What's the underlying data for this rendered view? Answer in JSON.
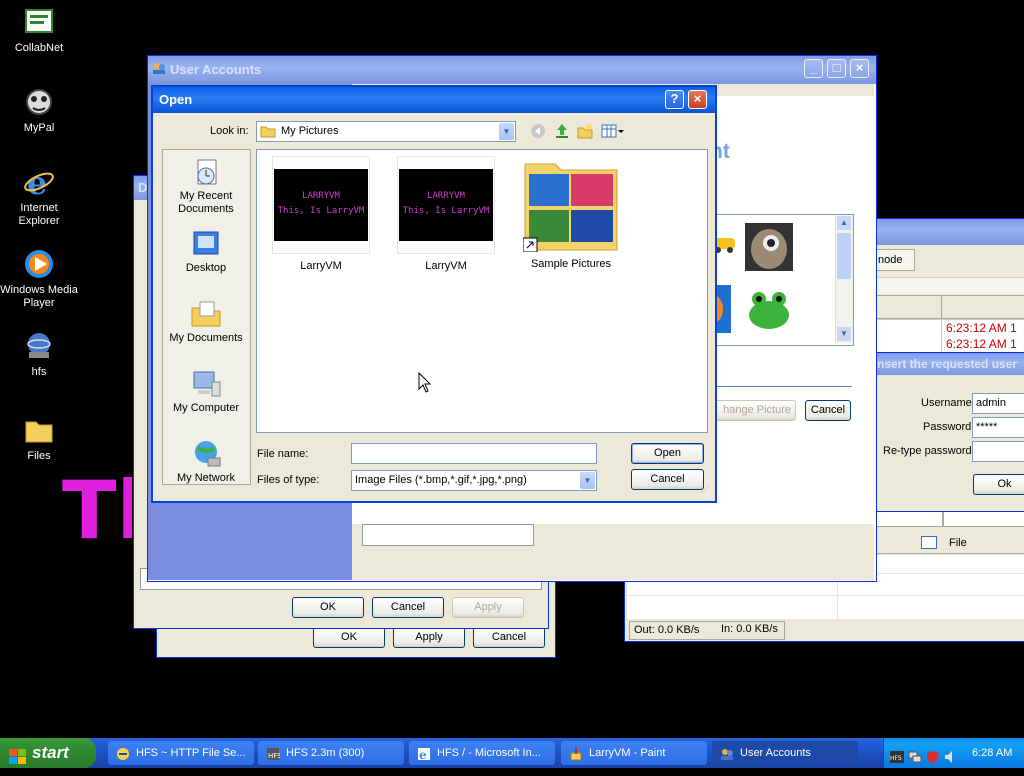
{
  "desktop": {
    "icons": [
      "CollabNet",
      "MyPal",
      "Internet Explorer",
      "Windows Media Player",
      "hfs",
      "Files"
    ],
    "background_text": "Th"
  },
  "user_accounts": {
    "title": "User Accounts",
    "heading_fragment": "nt",
    "change_picture_label": "hange Picture",
    "cancel_label": "Cancel",
    "ok_label": "OK",
    "apply_label": "Apply"
  },
  "back_dialog": {
    "title": "D",
    "ok_label": "OK",
    "cancel_label": "Cancel",
    "apply_label": "Apply"
  },
  "third_dialog": {
    "ok_label": "OK",
    "apply_label": "Apply",
    "cancel_label": "Cancel"
  },
  "hfs_window": {
    "column_fragment": "node",
    "log_time_1": "6:23:12 AM 1",
    "log_time_2": "6:23:12 AM 1",
    "file_column": "File",
    "status_out": "Out: 0.0 KB/s",
    "status_in": "In: 0.0 KB/s"
  },
  "login_dialog": {
    "title_fragment": "nsert the requested user",
    "username_label": "Username",
    "username_value": "admin",
    "password_label": "Password",
    "password_value": "*****",
    "retype_label": "Re-type password",
    "ok_label": "Ok"
  },
  "open_dialog": {
    "title": "Open",
    "look_in_label": "Look in:",
    "look_in_value": "My Pictures",
    "places": [
      "My Recent Documents",
      "Desktop",
      "My Documents",
      "My Computer",
      "My Network"
    ],
    "files": [
      {
        "name": "LarryVM",
        "thumb_line1": "LARRYVM",
        "thumb_line2": "This, Is LarryVM"
      },
      {
        "name": "LarryVM",
        "thumb_line1": "LARRYVM",
        "thumb_line2": "This, Is LarryVM"
      },
      {
        "name": "Sample Pictures"
      }
    ],
    "file_name_label": "File name:",
    "file_name_value": "",
    "files_of_type_label": "Files of type:",
    "files_of_type_value": "Image Files (*.bmp,*.gif,*.jpg,*.png)",
    "open_label": "Open",
    "cancel_label": "Cancel"
  },
  "taskbar": {
    "start_label": "start",
    "items": [
      "HFS ~ HTTP File Se...",
      "HFS 2.3m (300)",
      "HFS / - Microsoft In...",
      "LarryVM - Paint",
      "User Accounts"
    ],
    "clock": "6:28 AM"
  },
  "colors": {
    "title_active": "#0a5fe6",
    "thumb_text": "#d040d0",
    "log_red": "#cc0000",
    "start_green": "#3c9a3c"
  }
}
